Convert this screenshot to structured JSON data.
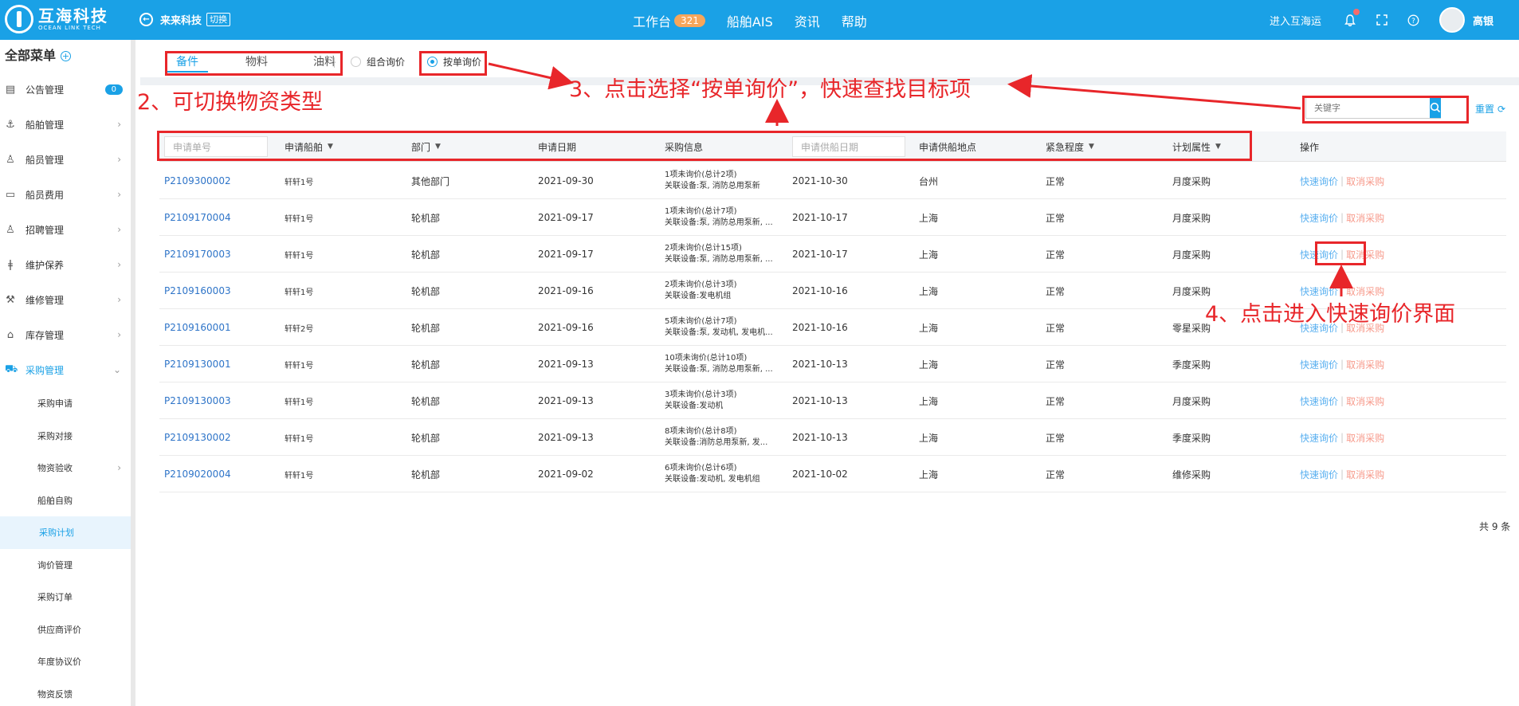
{
  "header": {
    "logo_cn": "互海科技",
    "logo_en": "OCEAN LINK TECH",
    "company": "来来科技",
    "switch_label": "切换",
    "nav": [
      {
        "label": "工作台",
        "badge": "321"
      },
      {
        "label": "船舶AIS"
      },
      {
        "label": "资讯"
      },
      {
        "label": "帮助"
      }
    ],
    "enter_label": "进入互海运",
    "username": "高银"
  },
  "sidebar": {
    "title": "全部菜单",
    "items": [
      {
        "label": "公告管理",
        "icon": "book-icon",
        "count": "0"
      },
      {
        "label": "船舶管理",
        "icon": "anchor-icon"
      },
      {
        "label": "船员管理",
        "icon": "user-icon"
      },
      {
        "label": "船员费用",
        "icon": "wallet-icon"
      },
      {
        "label": "招聘管理",
        "icon": "recruit-icon"
      },
      {
        "label": "维护保养",
        "icon": "maintenance-icon"
      },
      {
        "label": "维修管理",
        "icon": "wrench-icon"
      },
      {
        "label": "库存管理",
        "icon": "home-icon"
      },
      {
        "label": "采购管理",
        "icon": "cart-icon"
      }
    ],
    "sub_items": [
      "采购申请",
      "采购对接",
      "物资验收",
      "船舶自购",
      "采购计划",
      "询价管理",
      "采购订单",
      "供应商评价",
      "年度协议价",
      "物资反馈"
    ],
    "active_sub": "采购计划"
  },
  "tabs": [
    "备件",
    "物料",
    "油料"
  ],
  "radios": [
    "组合询价",
    "按单询价"
  ],
  "search": {
    "placeholder": "关键字",
    "reset": "重置"
  },
  "table": {
    "filters": {
      "apply_no_placeholder": "申请单号",
      "supply_date_placeholder": "申请供船日期"
    },
    "headers": {
      "ship": "申请船舶",
      "dept": "部门",
      "apply_date": "申请日期",
      "purchase_info": "采购信息",
      "supply_location": "申请供船地点",
      "urgency": "紧急程度",
      "plan_attr": "计划属性",
      "operation": "操作"
    },
    "rows": [
      {
        "no": "P2109300002",
        "ship": "轩轩1号",
        "dept": "其他部门",
        "date": "2021-09-30",
        "info1": "1项未询价(总计2项)",
        "info2": "关联设备:泵, 消防总用泵新",
        "supply_date": "2021-10-30",
        "loc": "台州",
        "urgency": "正常",
        "plan": "月度采购"
      },
      {
        "no": "P2109170004",
        "ship": "轩轩1号",
        "dept": "轮机部",
        "date": "2021-09-17",
        "info1": "1项未询价(总计7项)",
        "info2": "关联设备:泵, 消防总用泵新, ...",
        "supply_date": "2021-10-17",
        "loc": "上海",
        "urgency": "正常",
        "plan": "月度采购"
      },
      {
        "no": "P2109170003",
        "ship": "轩轩1号",
        "dept": "轮机部",
        "date": "2021-09-17",
        "info1": "2项未询价(总计15项)",
        "info2": "关联设备:泵, 消防总用泵新, ...",
        "supply_date": "2021-10-17",
        "loc": "上海",
        "urgency": "正常",
        "plan": "月度采购"
      },
      {
        "no": "P2109160003",
        "ship": "轩轩1号",
        "dept": "轮机部",
        "date": "2021-09-16",
        "info1": "2项未询价(总计3项)",
        "info2": "关联设备:发电机组",
        "supply_date": "2021-10-16",
        "loc": "上海",
        "urgency": "正常",
        "plan": "月度采购"
      },
      {
        "no": "P2109160001",
        "ship": "轩轩2号",
        "dept": "轮机部",
        "date": "2021-09-16",
        "info1": "5项未询价(总计7项)",
        "info2": "关联设备:泵, 发动机, 发电机...",
        "supply_date": "2021-10-16",
        "loc": "上海",
        "urgency": "正常",
        "plan": "零星采购"
      },
      {
        "no": "P2109130001",
        "ship": "轩轩1号",
        "dept": "轮机部",
        "date": "2021-09-13",
        "info1": "10项未询价(总计10项)",
        "info2": "关联设备:泵, 消防总用泵新, ...",
        "supply_date": "2021-10-13",
        "loc": "上海",
        "urgency": "正常",
        "plan": "季度采购"
      },
      {
        "no": "P2109130003",
        "ship": "轩轩1号",
        "dept": "轮机部",
        "date": "2021-09-13",
        "info1": "3项未询价(总计3项)",
        "info2": "关联设备:发动机",
        "supply_date": "2021-10-13",
        "loc": "上海",
        "urgency": "正常",
        "plan": "月度采购"
      },
      {
        "no": "P2109130002",
        "ship": "轩轩1号",
        "dept": "轮机部",
        "date": "2021-09-13",
        "info1": "8项未询价(总计8项)",
        "info2": "关联设备:消防总用泵新, 发...",
        "supply_date": "2021-10-13",
        "loc": "上海",
        "urgency": "正常",
        "plan": "季度采购"
      },
      {
        "no": "P2109020004",
        "ship": "轩轩1号",
        "dept": "轮机部",
        "date": "2021-09-02",
        "info1": "6项未询价(总计6项)",
        "info2": "关联设备:发动机, 发电机组",
        "supply_date": "2021-10-02",
        "loc": "上海",
        "urgency": "正常",
        "plan": "维修采购"
      }
    ],
    "op_quick": "快速询价",
    "op_cancel": "取消采购",
    "total": "共 9 条"
  },
  "annotations": {
    "a2": "2、可切换物资类型",
    "a3": "3、点击选择“按单询价”，快速查找目标项",
    "a4": "4、点击进入快速询价界面"
  },
  "colors": {
    "brand": "#1aa1e6",
    "annotation": "#e8262a",
    "link": "#2e74c8",
    "cancel": "#f79a8b"
  }
}
